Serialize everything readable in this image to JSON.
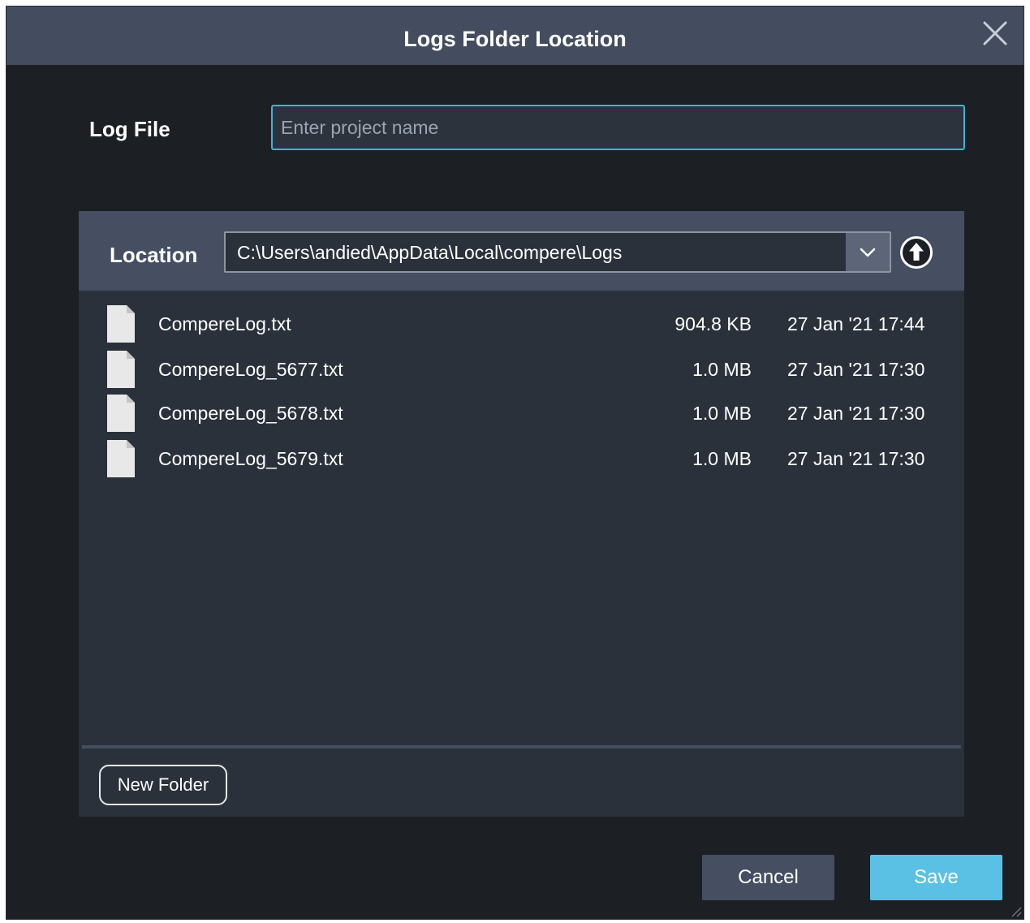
{
  "dialog": {
    "title": "Logs Folder Location",
    "close_icon": "close-icon"
  },
  "log_file": {
    "label": "Log File",
    "value": "",
    "placeholder": "Enter project name"
  },
  "location": {
    "label": "Location",
    "path": "C:\\Users\\andied\\AppData\\Local\\compere\\Logs",
    "dropdown_icon": "chevron-down-icon",
    "up_icon": "up-arrow-circle-icon"
  },
  "files": [
    {
      "name": "CompereLog.txt",
      "size": "904.8 KB",
      "date": "27 Jan '21 17:44",
      "icon": "file-icon"
    },
    {
      "name": "CompereLog_5677.txt",
      "size": "1.0 MB",
      "date": "27 Jan '21 17:30",
      "icon": "file-icon"
    },
    {
      "name": "CompereLog_5678.txt",
      "size": "1.0 MB",
      "date": "27 Jan '21 17:30",
      "icon": "file-icon"
    },
    {
      "name": "CompereLog_5679.txt",
      "size": "1.0 MB",
      "date": "27 Jan '21 17:30",
      "icon": "file-icon"
    }
  ],
  "buttons": {
    "new_folder": "New Folder",
    "cancel": "Cancel",
    "save": "Save"
  },
  "colors": {
    "accent": "#5bc1e4",
    "input_border": "#3fb4d3",
    "titlebar": "#444c5f",
    "background": "#1c1f24",
    "panel": "#2b313b"
  }
}
